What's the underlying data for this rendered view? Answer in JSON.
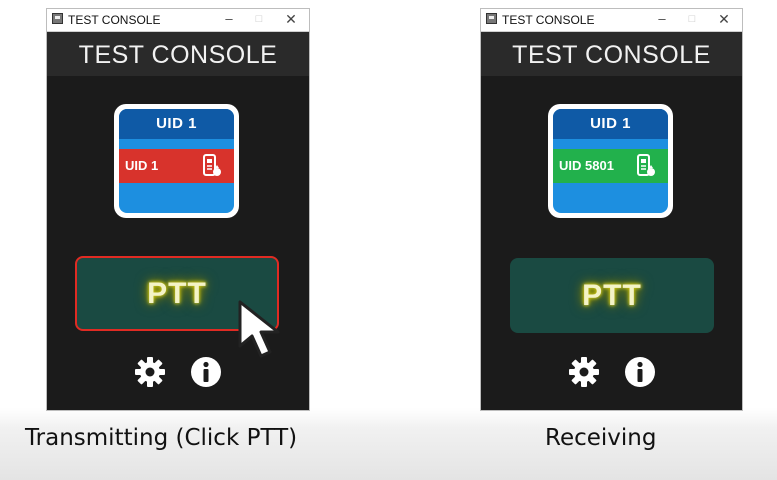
{
  "windows": [
    {
      "title": "TEST CONSOLE",
      "header": "TEST CONSOLE",
      "card": {
        "top_label": "UID 1",
        "status_label": "UID 1",
        "status_color": "#d8332c"
      },
      "ptt_label": "PTT",
      "ptt_outline": "#e02b23",
      "caption": "Transmitting (Click PTT)"
    },
    {
      "title": "TEST CONSOLE",
      "header": "TEST CONSOLE",
      "card": {
        "top_label": "UID 1",
        "status_label": "UID 5801",
        "status_color": "#22b14c"
      },
      "ptt_label": "PTT",
      "caption": "Receiving"
    }
  ],
  "titlebar_buttons": {
    "minimize": "–",
    "maximize": "□",
    "close": "✕"
  },
  "icons": [
    "app-icon",
    "radio-handset-icon",
    "gear-icon",
    "info-icon",
    "mouse-cursor-icon"
  ]
}
